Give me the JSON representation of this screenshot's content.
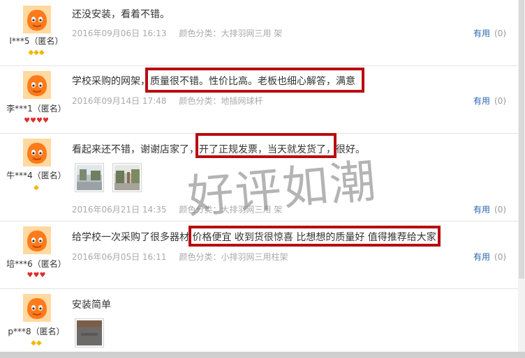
{
  "reviews": [
    {
      "user": "l***5（匿名）",
      "content": "还没安装，看着不错。",
      "date": "2016年09月06日 16:13",
      "category": "颜色分类：大排羽网三用 架",
      "helpful_label": "有用",
      "helpful_count": "(0)",
      "badge_count": 3,
      "badge_color": "#f2b600"
    },
    {
      "user": "李***1（匿名）",
      "content": "学校采购的网架，质量很不错。性价比高。老板也细心解答，满意",
      "date": "2016年09月14日 17:48",
      "category": "颜色分类：地插网球杆",
      "helpful_label": "有用",
      "helpful_count": "(0)",
      "badge_count": 4,
      "badge_color": "#e02d2d"
    },
    {
      "user": "牛***4（匿名）",
      "content": "看起来还不错，谢谢店家了，开了正规发票，当天就发货了，很好。",
      "date": "2016年06月21日 14:35",
      "category": "颜色分类：大排羽网三用 架",
      "helpful_label": "有用",
      "helpful_count": "(0)",
      "badge_count": 1,
      "badge_color": "#f2b600"
    },
    {
      "user": "培***6（匿名）",
      "content": "给学校一次采购了很多器材 价格便宜 收到货很惊喜 比想想的质量好 值得推荐给大家",
      "date": "2016年06月05日 16:11",
      "category": "颜色分类：小排羽网三用柱架",
      "helpful_label": "有用",
      "helpful_count": "(0)",
      "badge_count": 3,
      "badge_color": "#e02d2d"
    },
    {
      "user": "p***8（匿名）",
      "content": "安装简单",
      "badge_count": 2,
      "badge_color": "#f2b600"
    }
  ],
  "watermark": "好评如潮",
  "icons": {
    "avatar": "default-orange-avatar-icon",
    "gold_badge": "gold-diamond-icon",
    "red_badge": "red-heart-icon",
    "photo": "review-photo-icon"
  },
  "colors": {
    "highlight": "#b80d12",
    "link": "#2a66b0",
    "meta": "#aaaaaa"
  }
}
